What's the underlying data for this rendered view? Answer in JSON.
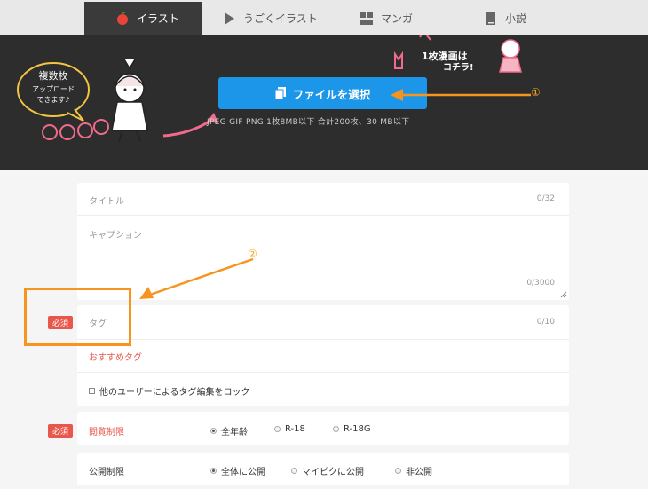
{
  "tabs": [
    {
      "label": "イラスト",
      "icon": "apple-icon"
    },
    {
      "label": "うごくイラスト",
      "icon": "play-icon"
    },
    {
      "label": "マンガ",
      "icon": "manga-panel-icon"
    },
    {
      "label": "小説",
      "icon": "book-icon"
    }
  ],
  "header": {
    "upload_label": "ファイルを選択",
    "formats": "JPEG   GIF   PNG    1枚8MB以下   合計200枚、30 MB以下",
    "marker1": "①",
    "bubble_text": [
      "複数枚",
      "アップロード",
      "できます♪"
    ],
    "manga_callout": [
      "1枚漫画は",
      "コチラ!"
    ]
  },
  "form": {
    "title_placeholder": "タイトル",
    "title_counter": "0/32",
    "caption_placeholder": "キャプション",
    "caption_counter": "0/3000",
    "required_badge": "必須",
    "tag_placeholder": "タグ",
    "tag_counter": "0/10",
    "recommended_tags": "おすすめタグ",
    "lock_tags_label": "他のユーザーによるタグ編集をロック",
    "marker2": "②",
    "age_restriction": {
      "label": "閲覧制限",
      "options": [
        "全年齢",
        "R-18",
        "R-18G"
      ]
    },
    "visibility": {
      "label": "公開制限",
      "options": [
        "全体に公開",
        "マイピクに公開",
        "非公開"
      ]
    }
  },
  "colors": {
    "accent_blue": "#1c96e8",
    "required_red": "#e8574b",
    "annotation_orange": "#f7941e",
    "header_dark": "#2d2d2d"
  }
}
